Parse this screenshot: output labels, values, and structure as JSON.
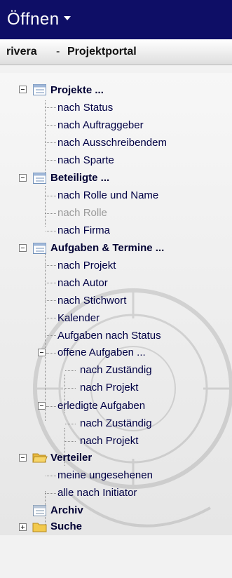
{
  "header": {
    "title": "Öffnen"
  },
  "subheader": {
    "user": "rivera",
    "separator": "-",
    "portal": "Projektportal"
  },
  "tree": {
    "projekte": {
      "label": "Projekte ...",
      "children": [
        "nach Status",
        "nach Auftraggeber",
        "nach Ausschreibendem",
        "nach Sparte"
      ]
    },
    "beteiligte": {
      "label": "Beteiligte ...",
      "children": [
        "nach Rolle und Name",
        "nach Rolle",
        "nach Firma"
      ]
    },
    "aufgaben": {
      "label": "Aufgaben & Termine ...",
      "children": [
        "nach Projekt",
        "nach Autor",
        "nach Stichwort",
        "Kalender",
        "Aufgaben nach Status"
      ],
      "offene": {
        "label": "offene Aufgaben ...",
        "children": [
          "nach Zuständig",
          "nach Projekt"
        ]
      },
      "erledigte": {
        "label": "erledigte Aufgaben",
        "children": [
          "nach Zuständig",
          "nach Projekt"
        ]
      }
    },
    "verteiler": {
      "label": "Verteiler",
      "children": [
        "meine ungesehenen",
        "alle nach Initiator"
      ]
    },
    "archiv": {
      "label": "Archiv"
    },
    "suche": {
      "label": "Suche"
    }
  }
}
